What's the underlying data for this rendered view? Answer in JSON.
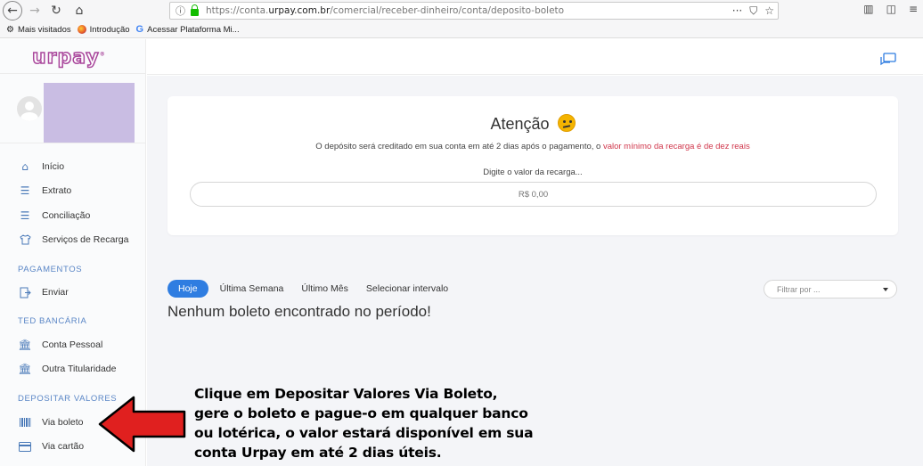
{
  "browser": {
    "url_prefix": "https://conta.",
    "url_domain": "urpay.com.br",
    "url_path": "/comercial/receber-dinheiro/conta/deposito-boleto",
    "bookmarks": [
      {
        "label": "Mais visitados",
        "icon": "gear-icon"
      },
      {
        "label": "Introdução",
        "icon": "firefox-icon"
      },
      {
        "label": "Acessar Plataforma Mi...",
        "icon": "google-icon"
      }
    ]
  },
  "sidebar": {
    "logo": "urpay",
    "items": [
      {
        "label": "Início",
        "icon": "home-icon"
      },
      {
        "label": "Extrato",
        "icon": "list-icon"
      },
      {
        "label": "Conciliação",
        "icon": "list-icon"
      },
      {
        "label": "Serviços de Recarga",
        "icon": "shirt-icon"
      }
    ],
    "sections": [
      {
        "title": "PAGAMENTOS",
        "items": [
          {
            "label": "Enviar",
            "icon": "send-icon"
          }
        ]
      },
      {
        "title": "TED BANCÁRIA",
        "items": [
          {
            "label": "Conta Pessoal",
            "icon": "bank-icon"
          },
          {
            "label": "Outra Titularidade",
            "icon": "bank-icon"
          }
        ]
      },
      {
        "title": "DEPOSITAR VALORES",
        "items": [
          {
            "label": "Via boleto",
            "icon": "barcode-icon"
          },
          {
            "label": "Via cartão",
            "icon": "card-icon"
          }
        ]
      }
    ]
  },
  "card": {
    "title": "Atenção",
    "description_part1": "O depósito será creditado em sua conta em até 2 dias após o pagamento, o ",
    "description_highlight": "valor mínimo da recarga é de dez reais",
    "amount_label": "Digite o valor da recarga...",
    "amount_placeholder": "R$ 0,00",
    "accent_color": "#d0364b"
  },
  "tabs": [
    {
      "label": "Hoje",
      "active": true
    },
    {
      "label": "Última Semana",
      "active": false
    },
    {
      "label": "Último Mês",
      "active": false
    },
    {
      "label": "Selecionar intervalo",
      "active": false
    }
  ],
  "filter": {
    "placeholder": "Filtrar por ..."
  },
  "empty_message": "Nenhum boleto encontrado no período!",
  "annotation": {
    "lines": [
      "Clique em Depositar Valores Via Boleto,",
      "gere o boleto e pague-o em qualquer banco",
      "ou lotérica, o valor estará disponível em sua",
      "conta Urpay em até 2 dias úteis."
    ],
    "arrow_color": "#e0201f"
  },
  "colors": {
    "primary": "#2f7de1",
    "brand": "#a9479c",
    "profile_block": "#c9bde3"
  }
}
